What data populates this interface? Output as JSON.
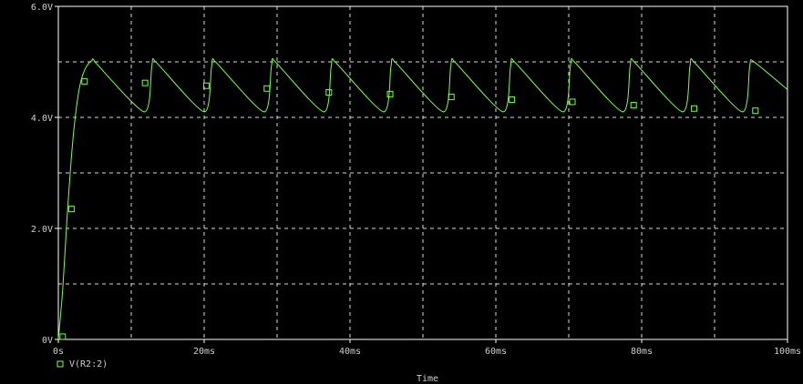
{
  "chart_data": {
    "type": "line",
    "xlabel": "Time",
    "ylabel": "",
    "xlim": [
      0,
      100
    ],
    "ylim": [
      0,
      6
    ],
    "x_unit": "ms",
    "x_ticks": [
      {
        "value": 0,
        "label": "0s"
      },
      {
        "value": 20,
        "label": "20ms"
      },
      {
        "value": 40,
        "label": "40ms"
      },
      {
        "value": 60,
        "label": "60ms"
      },
      {
        "value": 80,
        "label": "80ms"
      },
      {
        "value": 100,
        "label": "100ms"
      }
    ],
    "y_ticks": [
      {
        "value": 0,
        "label": "0V"
      },
      {
        "value": 2,
        "label": "2.0V"
      },
      {
        "value": 4,
        "label": "4.0V"
      },
      {
        "value": 6,
        "label": "6.0V"
      }
    ],
    "grid": true,
    "grid_style": "dashed",
    "legend_position": "bottom-left",
    "background_color": "#000000",
    "axis_color": "#ffffff",
    "grid_color": "#ffffff",
    "series": [
      {
        "name": "V(R2:2)",
        "color": "#7cff4c",
        "marker": "square",
        "x": [
          0,
          0.6,
          1.2,
          1.8,
          2.4,
          3.0,
          3.6,
          4.2,
          4.6,
          5.0,
          11.8,
          12.8,
          13.2,
          20.0,
          21.0,
          21.4,
          28.2,
          29.2,
          29.6,
          36.4,
          37.4,
          37.8,
          44.6,
          45.6,
          46.0,
          52.8,
          53.8,
          54.2,
          61.0,
          62.0,
          62.4,
          69.2,
          70.2,
          70.6,
          77.4,
          78.4,
          78.8,
          85.6,
          86.6,
          87.0,
          93.8,
          94.8,
          95.2,
          100
        ],
        "y": [
          0,
          0.9,
          2.2,
          3.3,
          4.1,
          4.6,
          4.85,
          4.98,
          5.02,
          5.0,
          4.1,
          4.9,
          5.02,
          4.1,
          4.9,
          5.02,
          4.1,
          4.9,
          5.02,
          4.1,
          4.9,
          5.02,
          4.1,
          4.9,
          5.02,
          4.1,
          4.9,
          5.02,
          4.1,
          4.9,
          5.02,
          4.1,
          4.9,
          5.02,
          4.1,
          4.9,
          5.02,
          4.1,
          4.9,
          5.02,
          4.1,
          4.9,
          5.02,
          4.5
        ],
        "markers": [
          {
            "x": 0.6,
            "y": 0.05
          },
          {
            "x": 1.8,
            "y": 2.35
          },
          {
            "x": 3.6,
            "y": 4.65
          },
          {
            "x": 11.9,
            "y": 4.62
          },
          {
            "x": 20.3,
            "y": 4.57
          },
          {
            "x": 28.6,
            "y": 4.52
          },
          {
            "x": 37.1,
            "y": 4.45
          },
          {
            "x": 45.5,
            "y": 4.42
          },
          {
            "x": 53.9,
            "y": 4.37
          },
          {
            "x": 62.2,
            "y": 4.32
          },
          {
            "x": 70.5,
            "y": 4.28
          },
          {
            "x": 78.9,
            "y": 4.22
          },
          {
            "x": 87.2,
            "y": 4.16
          },
          {
            "x": 95.6,
            "y": 4.12
          }
        ]
      }
    ]
  }
}
